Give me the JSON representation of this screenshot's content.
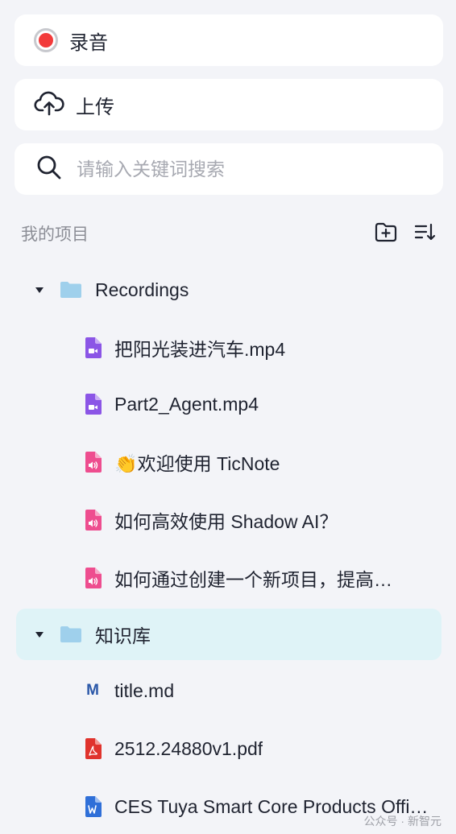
{
  "actions": {
    "record_label": "录音",
    "upload_label": "上传"
  },
  "search": {
    "placeholder": "请输入关键词搜索"
  },
  "projects": {
    "title": "我的项目"
  },
  "tree": {
    "folders": [
      {
        "name": "Recordings",
        "files": [
          {
            "name": "把阳光装进汽车.mp4",
            "type": "video"
          },
          {
            "name": "Part2_Agent.mp4",
            "type": "video"
          },
          {
            "name": "👏欢迎使用 TicNote",
            "type": "audio"
          },
          {
            "name": "如何高效使用 Shadow AI？",
            "type": "audio"
          },
          {
            "name": "如何通过创建一个新项目，提高…",
            "type": "audio"
          }
        ]
      },
      {
        "name": "知识库",
        "files": [
          {
            "name": "title.md",
            "type": "markdown"
          },
          {
            "name": "2512.24880v1.pdf",
            "type": "pdf"
          },
          {
            "name": "CES Tuya Smart Core Products Offi…",
            "type": "word"
          }
        ]
      }
    ]
  },
  "colors": {
    "record": "#f23a3a",
    "folder": "#9fd0ec",
    "video": "#8b55e6",
    "audio": "#ee4d8f",
    "pdf": "#e0332d",
    "word": "#2f6fd8",
    "selected": "#dff3f7"
  },
  "watermark": "公众号 · 新智元"
}
